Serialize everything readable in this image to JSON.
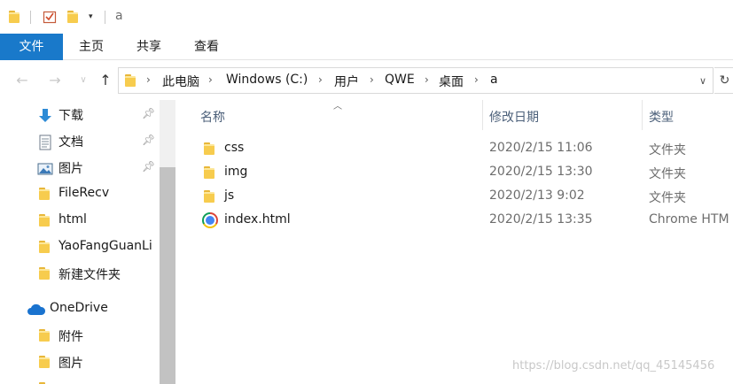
{
  "window": {
    "title": "a"
  },
  "ribbon": {
    "tabs": [
      {
        "label": "文件"
      },
      {
        "label": "主页"
      },
      {
        "label": "共享"
      },
      {
        "label": "查看"
      }
    ]
  },
  "address": {
    "breadcrumbs": [
      "此电脑",
      "Windows (C:)",
      "用户",
      "QWE",
      "桌面",
      "a"
    ]
  },
  "nav": {
    "quick_access": [
      {
        "label": "下载",
        "icon": "download-arrow-icon",
        "pinned": true
      },
      {
        "label": "文档",
        "icon": "document-icon",
        "pinned": true
      },
      {
        "label": "图片",
        "icon": "picture-icon",
        "pinned": true
      },
      {
        "label": "FileRecv",
        "icon": "folder-icon"
      },
      {
        "label": "html",
        "icon": "folder-icon"
      },
      {
        "label": "YaoFangGuanLi",
        "icon": "folder-icon"
      },
      {
        "label": "新建文件夹",
        "icon": "folder-icon"
      }
    ],
    "onedrive": {
      "label": "OneDrive",
      "items": [
        {
          "label": "附件"
        },
        {
          "label": "图片"
        }
      ]
    }
  },
  "columns": {
    "name": "名称",
    "date": "修改日期",
    "type": "类型"
  },
  "files": [
    {
      "name": "css",
      "date": "2020/2/15 11:06",
      "type": "文件夹",
      "icon": "folder-icon"
    },
    {
      "name": "img",
      "date": "2020/2/15 13:30",
      "type": "文件夹",
      "icon": "folder-icon"
    },
    {
      "name": "js",
      "date": "2020/2/13 9:02",
      "type": "文件夹",
      "icon": "folder-icon"
    },
    {
      "name": "index.html",
      "date": "2020/2/15 13:35",
      "type": "Chrome HTM",
      "icon": "chrome-icon"
    }
  ],
  "watermark": "https://blog.csdn.net/qq_45145456",
  "colors": {
    "accent": "#1979ca",
    "folder": "#f7cc4e"
  }
}
